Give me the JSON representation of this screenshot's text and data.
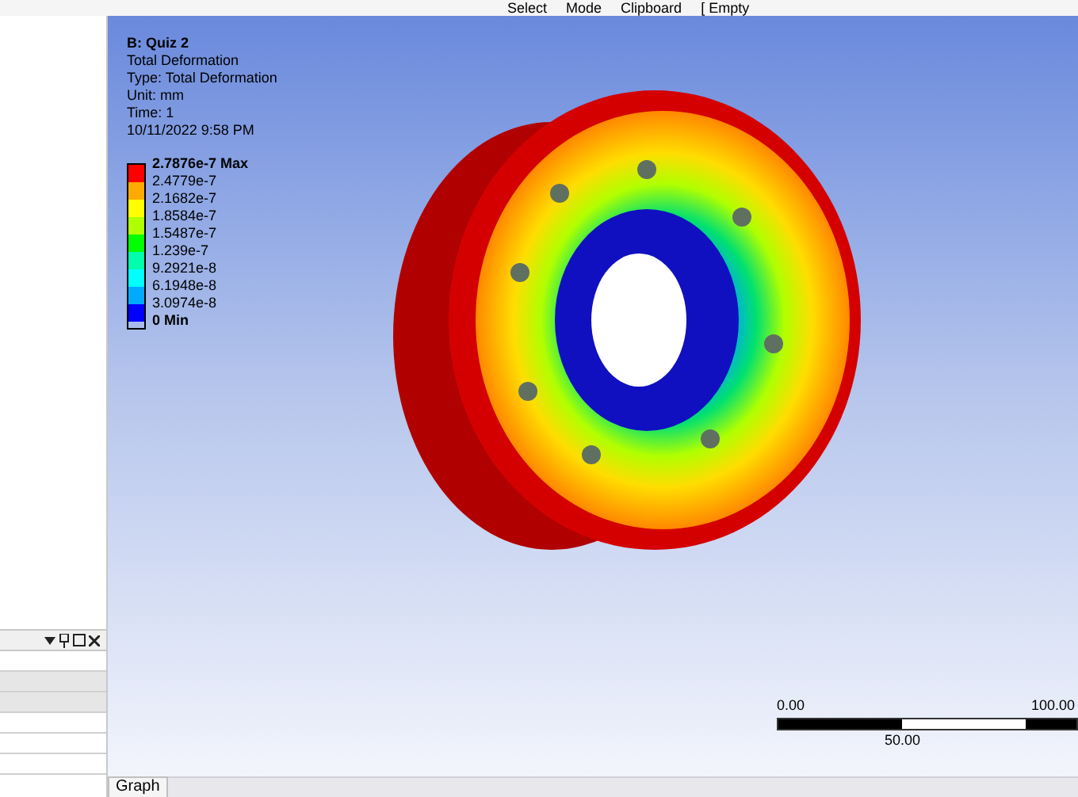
{
  "toolbar": {
    "items": [
      {
        "label": "Select"
      },
      {
        "label": "Mode"
      },
      {
        "label": "Clipboard"
      },
      {
        "label": "[ Empty"
      }
    ]
  },
  "viewport": {
    "info": [
      "B: Quiz 2",
      "Total Deformation",
      "Type: Total Deformation",
      "Unit: mm",
      "Time: 1",
      "10/11/2022 9:58 PM"
    ],
    "legend": {
      "bands": [
        {
          "color": "#ff0000"
        },
        {
          "color": "#ffaa00"
        },
        {
          "color": "#ffff00"
        },
        {
          "color": "#b0ff00"
        },
        {
          "color": "#00ff00"
        },
        {
          "color": "#00ffaa"
        },
        {
          "color": "#00ffff"
        },
        {
          "color": "#00aaff"
        },
        {
          "color": "#0000ff"
        }
      ],
      "labels": [
        "2.7876e-7 Max",
        "2.4779e-7",
        "2.1682e-7",
        "1.8584e-7",
        "1.5487e-7",
        "1.239e-7",
        "9.2921e-8",
        "6.1948e-8",
        "3.0974e-8",
        "0 Min"
      ]
    },
    "scale": {
      "labels": [
        "0.00",
        "100.00",
        "50.00"
      ]
    }
  },
  "bottom_panel": {
    "rows": [
      {
        "selected": false
      },
      {
        "selected": true
      },
      {
        "selected": true
      },
      {
        "selected": false
      },
      {
        "selected": false
      },
      {
        "selected": false
      }
    ]
  },
  "graph_tab": {
    "label": "Graph"
  }
}
